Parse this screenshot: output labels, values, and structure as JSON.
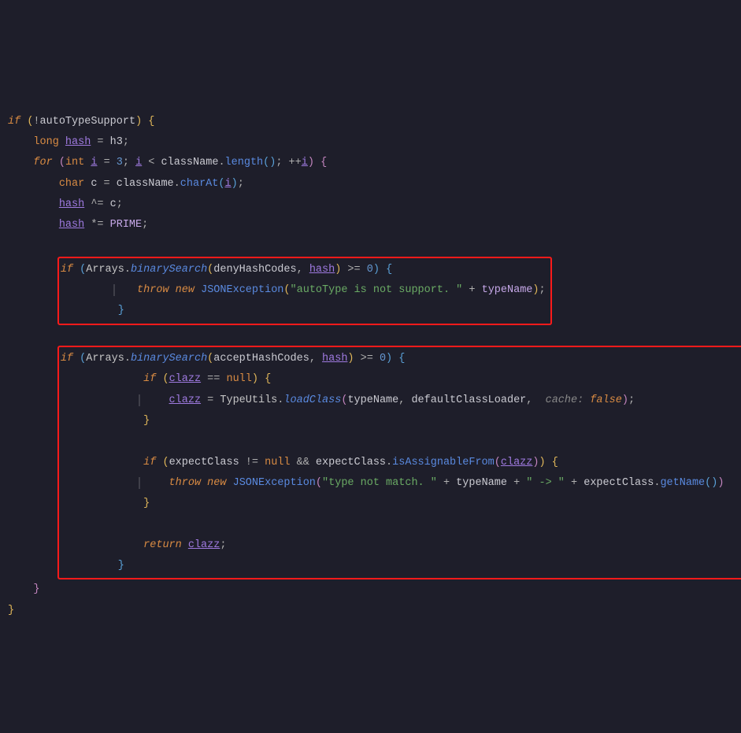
{
  "code": {
    "l1_if": "if",
    "l1_not": "!",
    "l1_var": "autoTypeSupport",
    "l2_type": "long",
    "l2_var": "hash",
    "l2_eq": " = ",
    "l2_rhs": "h3",
    "l3_for": "for",
    "l3_int": "int",
    "l3_i": "i",
    "l3_init": " = ",
    "l3_initval": "3",
    "l3_sep": "; ",
    "l3_cond_i": "i",
    "l3_lt": " < ",
    "l3_className": "className",
    "l3_dot": ".",
    "l3_length": "length",
    "l3_post": "; ++",
    "l4_char": "char",
    "l4_c": "c",
    "l4_eq": " = ",
    "l4_className": "className",
    "l4_charAt": "charAt",
    "l5_hash": "hash",
    "l5_op": " ^= ",
    "l5_c": "c",
    "l6_hash": "hash",
    "l6_op": " *= ",
    "l6_prime": "PRIME",
    "b1_if": "if",
    "b1_arrays": "Arrays",
    "b1_bsearch": "binarySearch",
    "b1_arg1": "denyHashCodes",
    "b1_arg2": "hash",
    "b1_ge": " >= ",
    "b1_zero": "0",
    "b1_throw": "throw",
    "b1_new": "new",
    "b1_exc": "JSONException",
    "b1_msg": "\"autoType is not support. \"",
    "b1_plus": " + ",
    "b1_typeName": "typeName",
    "b2_if": "if",
    "b2_arrays": "Arrays",
    "b2_bsearch": "binarySearch",
    "b2_arg1": "acceptHashCodes",
    "b2_arg2": "hash",
    "b2_ge": " >= ",
    "b2_zero": "0",
    "b2_ifnull_if": "if",
    "b2_clazz": "clazz",
    "b2_eqeq": " == ",
    "b2_null": "null",
    "b2_assign_clazz": "clazz",
    "b2_eq": " = ",
    "b2_typeutils": "TypeUtils",
    "b2_loadClass": "loadClass",
    "b2_lc_a1": "typeName",
    "b2_lc_a2": "defaultClassLoader",
    "b2_lc_hint": "cache:",
    "b2_lc_false": "false",
    "b3_if": "if",
    "b3_expectClass": "expectClass",
    "b3_ne": " != ",
    "b3_null": "null",
    "b3_and": " && ",
    "b3_isAssign": "isAssignableFrom",
    "b3_clazz": "clazz",
    "b3_throw": "throw",
    "b3_new": "new",
    "b3_exc": "JSONException",
    "b3_msg": "\"type not match. \"",
    "b3_plus": " + ",
    "b3_typeName": "typeName",
    "b3_arrow": "\" -> \"",
    "b3_expectClass2": "expectClass",
    "b3_getName": "getName",
    "b4_return": "return",
    "b4_clazz": "clazz"
  },
  "highlights": [
    {
      "label": "deny-check-block"
    },
    {
      "label": "accept-check-block"
    }
  ]
}
